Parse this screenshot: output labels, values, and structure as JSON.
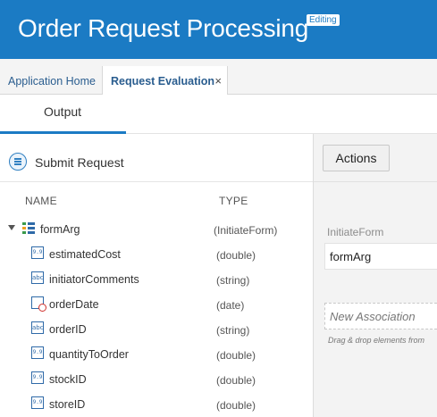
{
  "header": {
    "title": "Order Request Processing",
    "badge": "Editing"
  },
  "tabs": [
    {
      "label": "Application Home"
    },
    {
      "label": "Request Evaluation",
      "close": "×"
    }
  ],
  "subtabs": [
    {
      "label": "Output"
    }
  ],
  "left_panel": {
    "submit_label": "Submit Request",
    "columns": {
      "name": "NAME",
      "type": "TYPE"
    },
    "root": {
      "name": "formArg",
      "type": "(InitiateForm)"
    },
    "fields": [
      {
        "name": "estimatedCost",
        "type": "(double)",
        "icon": "number-field-icon",
        "glyph": "9.9"
      },
      {
        "name": "initiatorComments",
        "type": "(string)",
        "icon": "string-field-icon",
        "glyph": "abc"
      },
      {
        "name": "orderDate",
        "type": "(date)",
        "icon": "date-field-icon",
        "glyph": ""
      },
      {
        "name": "orderID",
        "type": "(string)",
        "icon": "string-field-icon",
        "glyph": "abc"
      },
      {
        "name": "quantityToOrder",
        "type": "(double)",
        "icon": "number-field-icon",
        "glyph": "9.9"
      },
      {
        "name": "stockID",
        "type": "(double)",
        "icon": "number-field-icon",
        "glyph": "9.9"
      },
      {
        "name": "storeID",
        "type": "(double)",
        "icon": "number-field-icon",
        "glyph": "9.9"
      }
    ]
  },
  "right_panel": {
    "actions_label": "Actions",
    "type_label": "InitiateForm",
    "field_value": "formArg",
    "drop_placeholder": "New Association",
    "drop_hint": "Drag & drop elements from"
  },
  "colors": {
    "brand": "#1b7bc4",
    "tab_text": "#2a5d8f",
    "date_marker": "#d0312d"
  }
}
